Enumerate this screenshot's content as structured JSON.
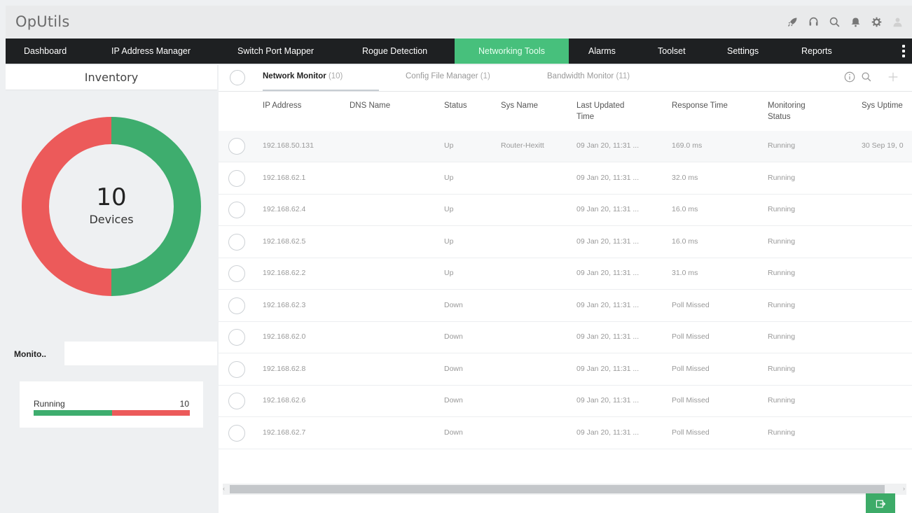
{
  "app": {
    "title": "OpUtils"
  },
  "top_icons": [
    "rocket-icon",
    "headset-icon",
    "search-icon",
    "bell-icon",
    "gear-icon",
    "user-icon"
  ],
  "nav": {
    "items": [
      {
        "label": "Dashboard"
      },
      {
        "label": "IP Address Manager"
      },
      {
        "label": "Switch Port Mapper"
      },
      {
        "label": "Rogue Detection"
      },
      {
        "label": "Networking Tools",
        "active": true
      },
      {
        "label": "Alarms"
      },
      {
        "label": "Toolset"
      },
      {
        "label": "Settings"
      },
      {
        "label": "Reports"
      }
    ]
  },
  "inventory": {
    "title": "Inventory",
    "device_count": "10",
    "device_label": "Devices",
    "donut": {
      "up": 5,
      "down": 5,
      "up_color": "#3ead6e",
      "down_color": "#ec5a5a"
    }
  },
  "monitor_filter": {
    "label": "Monito..",
    "value": ""
  },
  "monitoring_status": {
    "label": "Running",
    "count": "10",
    "fraction_up": 0.5,
    "colors": {
      "up": "#3ead6e",
      "down": "#ec5a5a"
    }
  },
  "tabs": [
    {
      "label": "Network Monitor",
      "count": "(10)",
      "active": true
    },
    {
      "label": "Config File Manager",
      "count": "(1)"
    },
    {
      "label": "Bandwidth Monitor",
      "count": "(11)"
    }
  ],
  "table": {
    "columns": [
      "IP Address",
      "DNS Name",
      "Status",
      "Sys Name",
      "Last Updated\nTime",
      "Response Time",
      "Monitoring\nStatus",
      "Sys Uptime"
    ],
    "rows": [
      {
        "ip": "192.168.50.131",
        "dns": "",
        "status": "Up",
        "sysname": "Router-Hexitt",
        "updated": "09 Jan 20, 11:31 ...",
        "response": "169.0 ms",
        "monitoring": "Running",
        "uptime": "30 Sep 19, 0"
      },
      {
        "ip": "192.168.62.1",
        "dns": "",
        "status": "Up",
        "sysname": "",
        "updated": "09 Jan 20, 11:31 ...",
        "response": "32.0 ms",
        "monitoring": "Running",
        "uptime": ""
      },
      {
        "ip": "192.168.62.4",
        "dns": "",
        "status": "Up",
        "sysname": "",
        "updated": "09 Jan 20, 11:31 ...",
        "response": "16.0 ms",
        "monitoring": "Running",
        "uptime": ""
      },
      {
        "ip": "192.168.62.5",
        "dns": "",
        "status": "Up",
        "sysname": "",
        "updated": "09 Jan 20, 11:31 ...",
        "response": "16.0 ms",
        "monitoring": "Running",
        "uptime": ""
      },
      {
        "ip": "192.168.62.2",
        "dns": "",
        "status": "Up",
        "sysname": "",
        "updated": "09 Jan 20, 11:31 ...",
        "response": "31.0 ms",
        "monitoring": "Running",
        "uptime": ""
      },
      {
        "ip": "192.168.62.3",
        "dns": "",
        "status": "Down",
        "sysname": "",
        "updated": "09 Jan 20, 11:31 ...",
        "response": "Poll Missed",
        "monitoring": "Running",
        "uptime": ""
      },
      {
        "ip": "192.168.62.0",
        "dns": "",
        "status": "Down",
        "sysname": "",
        "updated": "09 Jan 20, 11:31 ...",
        "response": "Poll Missed",
        "monitoring": "Running",
        "uptime": ""
      },
      {
        "ip": "192.168.62.8",
        "dns": "",
        "status": "Down",
        "sysname": "",
        "updated": "09 Jan 20, 11:31 ...",
        "response": "Poll Missed",
        "monitoring": "Running",
        "uptime": ""
      },
      {
        "ip": "192.168.62.6",
        "dns": "",
        "status": "Down",
        "sysname": "",
        "updated": "09 Jan 20, 11:31 ...",
        "response": "Poll Missed",
        "monitoring": "Running",
        "uptime": ""
      },
      {
        "ip": "192.168.62.7",
        "dns": "",
        "status": "Down",
        "sysname": "",
        "updated": "09 Jan 20, 11:31 ...",
        "response": "Poll Missed",
        "monitoring": "Running",
        "uptime": ""
      }
    ]
  },
  "footer": {
    "export_icon": "export-icon"
  }
}
